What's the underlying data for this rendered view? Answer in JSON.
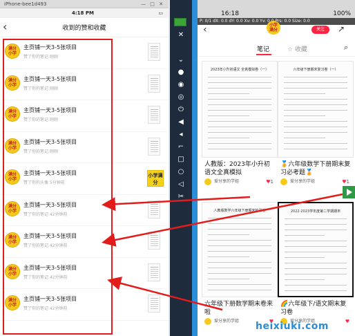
{
  "left": {
    "window_title": "iPhone-bee1d493",
    "status": {
      "carrier": "",
      "time": "4:18 PM",
      "battery": ""
    },
    "nav_title": "收到的赞和收藏",
    "rows": [
      {
        "name": "主页铺一天3-5张项目",
        "sub": "赞了你的笔记  刚刚",
        "thumb": "doc"
      },
      {
        "name": "主页铺一天3-5张项目",
        "sub": "赞了你的笔记  刚刚",
        "thumb": "doc"
      },
      {
        "name": "主页铺一天3-5张项目",
        "sub": "赞了你的笔记  刚刚",
        "thumb": "doc"
      },
      {
        "name": "主页铺一天3-5张项目",
        "sub": "赞了你的笔记  刚刚",
        "thumb": "doc"
      },
      {
        "name": "主页铺一天3-5张项目",
        "sub": "赞了你的头像  5分钟前",
        "thumb": "小学满分"
      },
      {
        "name": "主页铺一天3-5张项目",
        "sub": "赞了你的笔记  42分钟前",
        "thumb": "doc"
      },
      {
        "name": "主页铺一天3-5张项目",
        "sub": "赞了你的笔记  42分钟前",
        "thumb": "doc"
      },
      {
        "name": "主页铺一天3-5张项目",
        "sub": "赞了你的笔记  42分钟前",
        "thumb": "doc"
      },
      {
        "name": "主页铺一天3-5张项目",
        "sub": "赞了你的笔记  42分钟前",
        "thumb": "doc"
      }
    ],
    "avatar_text": "满分\n小学"
  },
  "right": {
    "status": {
      "time": "16:18",
      "battery": "100%"
    },
    "touch_bar": "P: 0/1   dX: 0.0   dY: 0.0   Xv: 0.0   Yv: 0.0   Prs: 0.0   Size: 0.0",
    "avatar_text": "小学\n满分",
    "follow_label": "关注",
    "tabs": [
      {
        "label": "笔记",
        "active": true
      },
      {
        "label": "☆ 收藏",
        "active": false
      }
    ],
    "cards": [
      {
        "title": "人教版：2023年小升初语文全真模拟",
        "paper_heading": "2023年小升初语文 全真模拟卷（一）",
        "author": "爱分享的学姐",
        "likes": "1"
      },
      {
        "title": "🏅六年级数学下册期末复习必考题🏅",
        "paper_heading": "六年级下册期末复习卷（一）",
        "author": "爱分享的学姐",
        "likes": "1"
      },
      {
        "title": "六年级下册数学期末卷来啦",
        "paper_heading": "人教版数学六年级下册期末检测卷",
        "author": "爱分享的学姐",
        "likes": ""
      },
      {
        "title": "🌈六年级下/语文期末复习卷",
        "paper_heading": "2022-2023学年度第二学期期末",
        "author": "爱分享的学姐",
        "likes": ""
      }
    ]
  },
  "watermark": "heixiuki.com",
  "colors": {
    "highlight_red": "#e21b1b",
    "brand_red": "#ff2442",
    "avatar_yellow": "#f7c91c",
    "toolbar_bg": "#1d2b3c"
  }
}
